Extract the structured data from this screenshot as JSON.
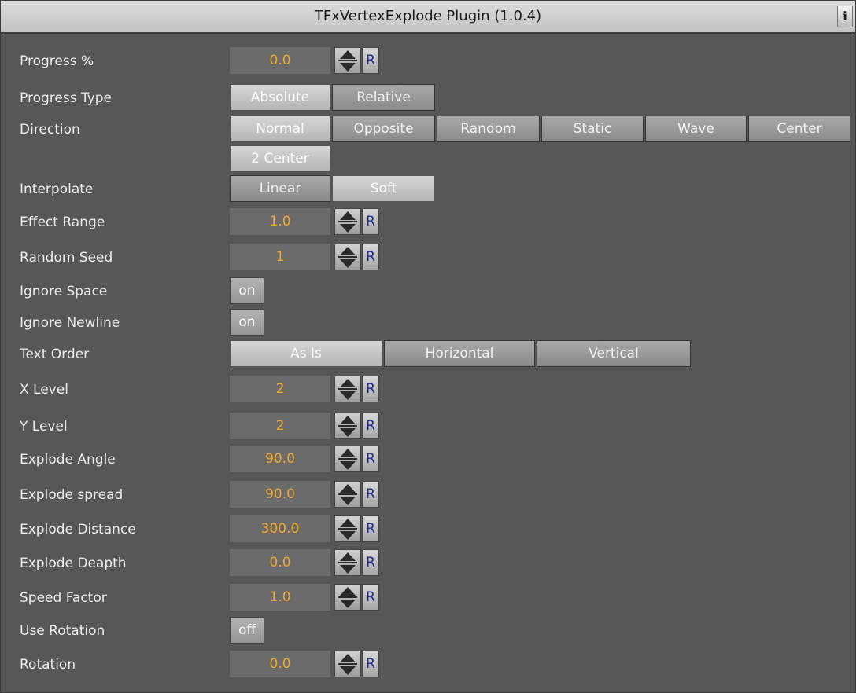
{
  "title": "TFxVertexExplode Plugin (1.0.4)",
  "info_label": "i",
  "reset_label": "R",
  "progress": {
    "label": "Progress %",
    "value": "0.0"
  },
  "progress_type": {
    "label": "Progress Type",
    "options": [
      "Absolute",
      "Relative"
    ],
    "selected": "Absolute"
  },
  "direction": {
    "label": "Direction",
    "options": [
      "Normal",
      "Opposite",
      "Random",
      "Static",
      "Wave",
      "Center",
      "2 Center"
    ],
    "selected": "Normal"
  },
  "interpolate": {
    "label": "Interpolate",
    "options": [
      "Linear",
      "Soft"
    ],
    "selected": "Soft"
  },
  "effect_range": {
    "label": "Effect Range",
    "value": "1.0"
  },
  "random_seed": {
    "label": "Random Seed",
    "value": "1"
  },
  "ignore_space": {
    "label": "Ignore Space",
    "value": "on"
  },
  "ignore_newline": {
    "label": "Ignore Newline",
    "value": "on"
  },
  "text_order": {
    "label": "Text Order",
    "options": [
      "As Is",
      "Horizontal",
      "Vertical"
    ],
    "selected": "As Is"
  },
  "x_level": {
    "label": "X Level",
    "value": "2"
  },
  "y_level": {
    "label": "Y Level",
    "value": "2"
  },
  "explode_angle": {
    "label": "Explode Angle",
    "value": "90.0"
  },
  "explode_spread": {
    "label": "Explode spread",
    "value": "90.0"
  },
  "explode_distance": {
    "label": "Explode Distance",
    "value": "300.0"
  },
  "explode_deapth": {
    "label": "Explode Deapth",
    "value": "0.0"
  },
  "speed_factor": {
    "label": "Speed Factor",
    "value": "1.0"
  },
  "use_rotation": {
    "label": "Use Rotation",
    "value": "off"
  },
  "rotation": {
    "label": "Rotation",
    "value": "0.0"
  },
  "colors": {
    "value_text": "#f0a830",
    "reset_text": "#1d2a8a",
    "panel_bg": "#575757",
    "title_bg": "#c4c4c4"
  }
}
